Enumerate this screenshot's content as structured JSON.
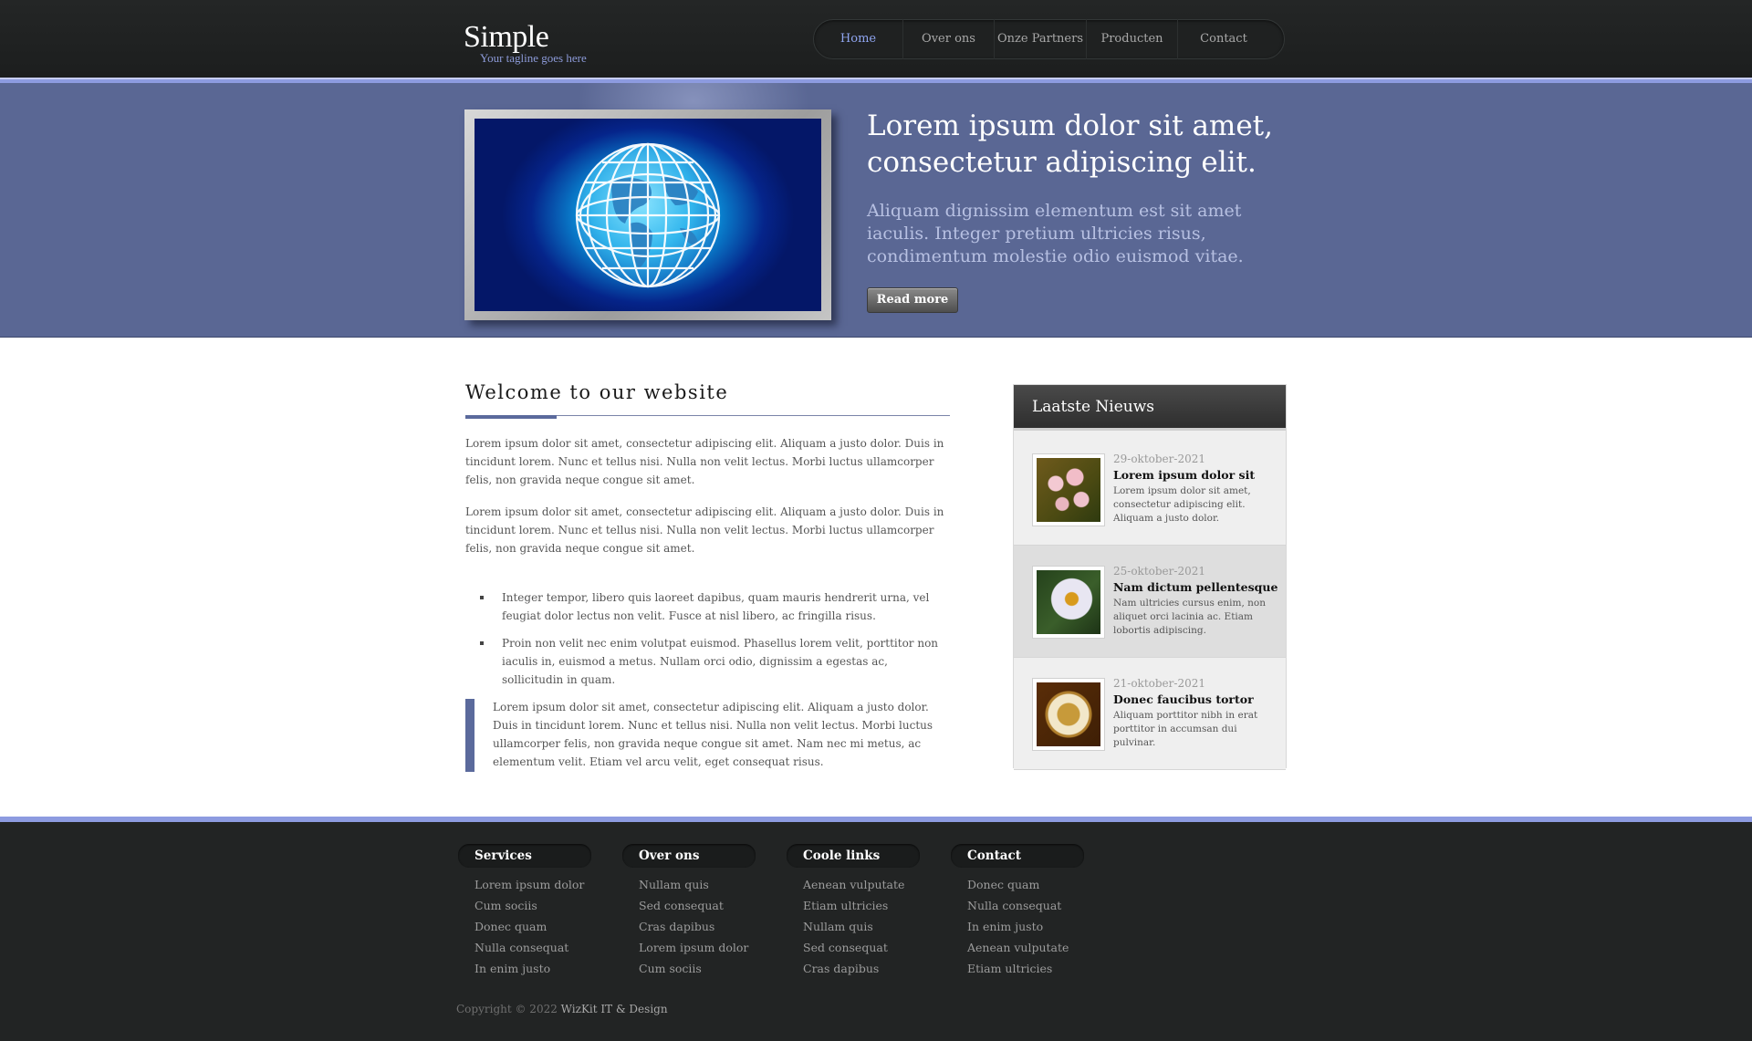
{
  "site": {
    "title": "Simple",
    "tagline": "Your tagline goes here"
  },
  "nav": {
    "items": [
      {
        "label": "Home",
        "active": true
      },
      {
        "label": "Over ons",
        "active": false
      },
      {
        "label": "Onze Partners",
        "active": false
      },
      {
        "label": "Producten",
        "active": false
      },
      {
        "label": "Contact",
        "active": false
      }
    ]
  },
  "hero": {
    "title": "Lorem ipsum dolor sit amet, consectetur adipiscing elit.",
    "text": "Aliquam dignissim elementum est sit amet iaculis. Integer pretium ultricies risus, condimentum molestie odio euismod vitae.",
    "button_label": "Read more"
  },
  "main": {
    "title": "Welcome to our website",
    "paragraphs": [
      "Lorem ipsum dolor sit amet, consectetur adipiscing elit. Aliquam a justo dolor. Duis in tincidunt lorem. Nunc et tellus nisi. Nulla non velit lectus. Morbi luctus ullamcorper felis, non gravida neque congue sit amet.",
      "Lorem ipsum dolor sit amet, consectetur adipiscing elit. Aliquam a justo dolor. Duis in tincidunt lorem. Nunc et tellus nisi. Nulla non velit lectus. Morbi luctus ullamcorper felis, non gravida neque congue sit amet."
    ],
    "bullets": [
      "Integer tempor, libero quis laoreet dapibus, quam mauris hendrerit urna, vel feugiat dolor lectus non velit. Fusce at nisl libero, ac fringilla risus.",
      "Proin non velit nec enim volutpat euismod. Phasellus lorem velit, porttitor non iaculis in, euismod a metus. Nullam orci odio, dignissim a egestas ac, sollicitudin in quam."
    ],
    "quote": "Lorem ipsum dolor sit amet, consectetur adipiscing elit. Aliquam a justo dolor. Duis in tincidunt lorem. Nunc et tellus nisi. Nulla non velit lectus. Morbi luctus ullamcorper felis, non gravida neque congue sit amet. Nam nec mi metus, ac elementum velit. Etiam vel arcu velit, eget consequat risus."
  },
  "news": {
    "heading": "Laatste Nieuws",
    "items": [
      {
        "date": "29-oktober-2021",
        "title": "Lorem ipsum dolor sit",
        "text": "Lorem ipsum dolor sit amet, consectetur adipiscing elit. Aliquam a justo dolor.",
        "thumb": "orchid-photo"
      },
      {
        "date": "25-oktober-2021",
        "title": "Nam dictum pellentesque",
        "text": "Nam ultricies cursus enim, non aliquet orci lacinia ac. Etiam lobortis adipiscing.",
        "thumb": "bee-on-daisy-photo"
      },
      {
        "date": "21-oktober-2021",
        "title": "Donec faucibus tortor",
        "text": "Aliquam porttitor nibh in erat porttitor in accumsan dui pulvinar.",
        "thumb": "coffee-cup-photo"
      }
    ]
  },
  "footer": {
    "columns": [
      {
        "heading": "Services",
        "links": [
          "Lorem ipsum dolor",
          "Cum sociis",
          "Donec quam",
          "Nulla consequat",
          "In enim justo"
        ]
      },
      {
        "heading": "Over ons",
        "links": [
          "Nullam quis",
          "Sed consequat",
          "Cras dapibus",
          "Lorem ipsum dolor",
          "Cum sociis"
        ]
      },
      {
        "heading": "Coole links",
        "links": [
          "Aenean vulputate",
          "Etiam ultricies",
          "Nullam quis",
          "Sed consequat",
          "Cras dapibus"
        ]
      },
      {
        "heading": "Contact",
        "links": [
          "Donec quam",
          "Nulla consequat",
          "In enim justo",
          "Aenean vulputate",
          "Etiam ultricies"
        ]
      }
    ],
    "copyright_prefix": "Copyright © 2022 ",
    "copyright_link": "WizKit IT & Design"
  },
  "colors": {
    "accent": "#5b6a9c",
    "nav_active": "#8fa5f0",
    "header_bg": "#222424",
    "hero_bg": "#5a6794"
  }
}
